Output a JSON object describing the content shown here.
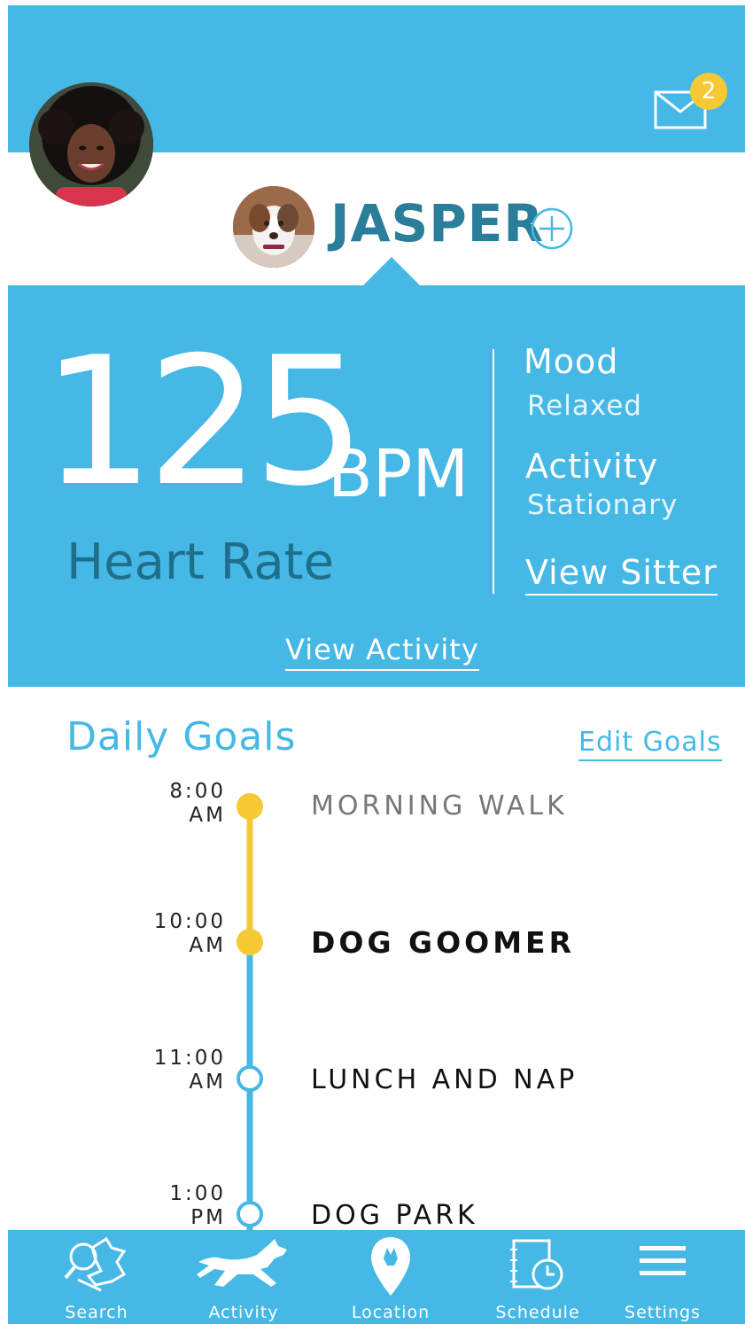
{
  "header": {
    "mail_badge_count": "2",
    "pet_name": "JASPER"
  },
  "stats": {
    "heart_rate_value": "125",
    "heart_rate_unit": "BPM",
    "heart_rate_label": "Heart Rate",
    "mood_title": "Mood",
    "mood_value": "Relaxed",
    "activity_title": "Activity",
    "activity_value": "Stationary",
    "view_sitter": "View Sitter",
    "view_activity": "View Activity"
  },
  "goals": {
    "title": "Daily Goals",
    "edit_label": "Edit Goals",
    "items": [
      {
        "time": "8:00",
        "period": "AM",
        "label": "MORNING WALK",
        "status": "completed"
      },
      {
        "time": "10:00",
        "period": "AM",
        "label": "DOG GOOMER",
        "status": "current"
      },
      {
        "time": "11:00",
        "period": "AM",
        "label": "LUNCH AND NAP",
        "status": "upcoming"
      },
      {
        "time": "1:00",
        "period": "PM",
        "label": "DOG PARK",
        "status": "upcoming"
      }
    ]
  },
  "colors": {
    "primary": "#45b8e6",
    "accent_yellow": "#f7c934",
    "heart_rate_label": "#1e6f8a",
    "pet_name": "#2a7e99"
  },
  "tabs": [
    {
      "label": "Search",
      "icon": "search-dog-icon"
    },
    {
      "label": "Activity",
      "icon": "running-dog-icon"
    },
    {
      "label": "Location",
      "icon": "location-pin-icon"
    },
    {
      "label": "Schedule",
      "icon": "schedule-icon"
    },
    {
      "label": "Settings",
      "icon": "menu-icon"
    }
  ]
}
